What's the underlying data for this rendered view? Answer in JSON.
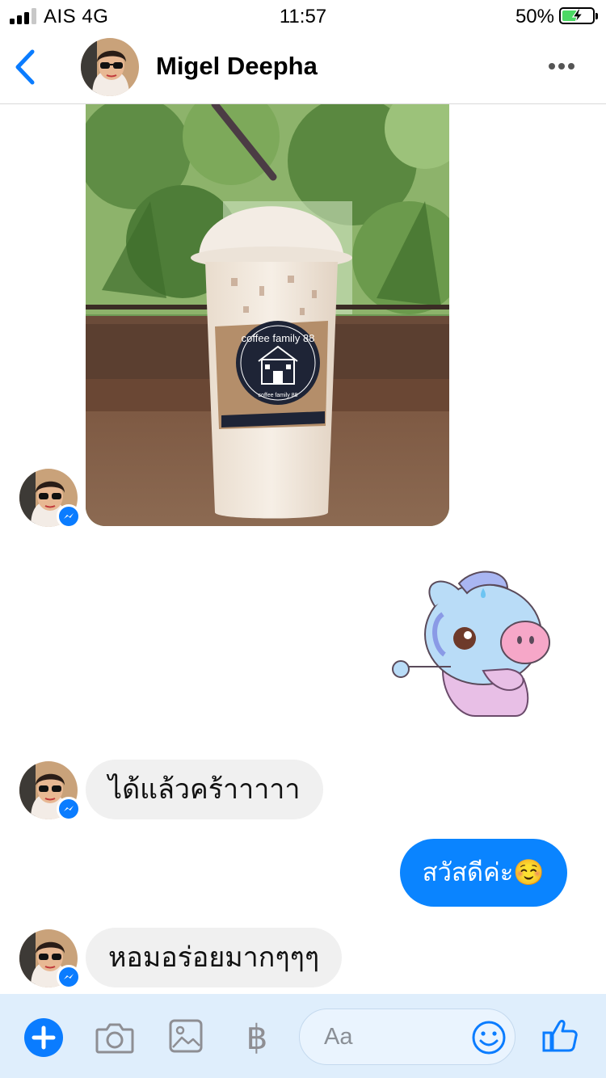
{
  "status_bar": {
    "carrier": "AIS 4G",
    "time": "11:57",
    "battery_percent_label": "50%",
    "battery_level": 0.5,
    "signal_bars_active": 3,
    "signal_bars_total": 4
  },
  "header": {
    "contact_name": "Migel Deepha",
    "back_icon": "chevron-left-icon",
    "more_icon": "ellipsis-icon"
  },
  "conversation": {
    "photo_message": {
      "cup_label_top": "coffee family 88",
      "cup_label_bottom": "coffee family 88"
    },
    "messages": [
      {
        "sender": "contact",
        "text": "ได้แล้วคร้าาาาา"
      },
      {
        "sender": "me",
        "text": "สวัสดีค่ะ☺️"
      },
      {
        "sender": "contact",
        "text": "หอมอร่อยมากๆๆๆ"
      }
    ]
  },
  "composer": {
    "placeholder": "Aa",
    "baht_symbol": "฿",
    "icons": [
      "plus-icon",
      "camera-icon",
      "image-icon",
      "baht-icon",
      "emoji-icon",
      "thumbs-up-icon"
    ]
  },
  "colors": {
    "messenger_blue": "#0a84ff",
    "incoming_bubble": "#f0f0f0",
    "composer_bg": "#dfeefc",
    "battery_green": "#4cd964"
  }
}
